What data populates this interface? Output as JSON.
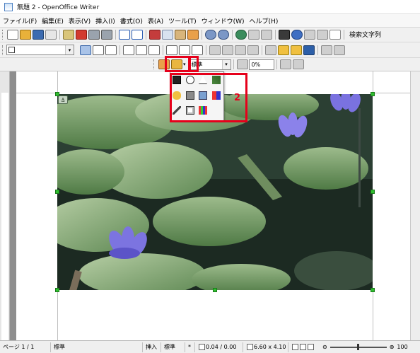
{
  "window": {
    "title": "無題 2 - OpenOffice Writer"
  },
  "menu": [
    "ファイル(F)",
    "編集(E)",
    "表示(V)",
    "挿入(I)",
    "書式(O)",
    "表(A)",
    "ツール(T)",
    "ウィンドウ(W)",
    "ヘルプ(H)"
  ],
  "toolbar1": {
    "search_label": "検索文字列"
  },
  "toolbar2": {
    "style_combo_value": ""
  },
  "toolbar3": {
    "filter_value": "標準",
    "transparency_value": "0%"
  },
  "callout": {
    "number": "2"
  },
  "statusbar": {
    "page": "ページ 1 / 1",
    "style": "標準",
    "insert_mode": "挿入",
    "selection_mode": "標準",
    "position": "0.04 / 0.00",
    "size": "6.60 x 4.10",
    "zoom": "100"
  },
  "colors": {
    "accent_red": "#e6001b",
    "handle_green": "#2fbf2f"
  }
}
